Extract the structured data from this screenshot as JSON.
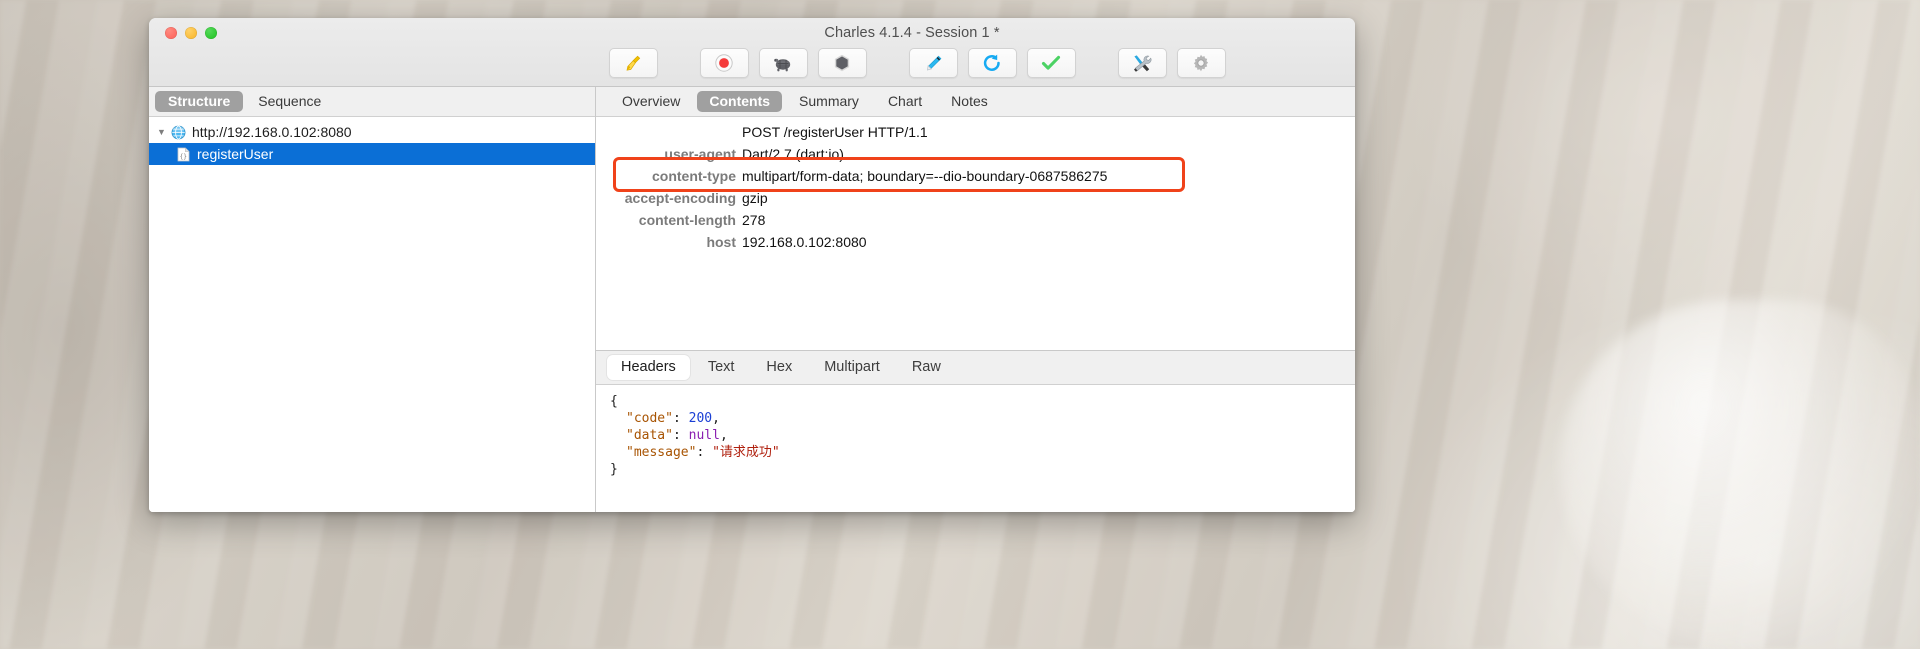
{
  "window": {
    "title": "Charles 4.1.4 - Session 1 *",
    "traffic_lights": [
      "close",
      "minimize",
      "maximize"
    ]
  },
  "toolbar": {
    "buttons": [
      {
        "name": "clear-session-button",
        "icon": "broom-icon",
        "label": "Clear Session"
      },
      {
        "name": "record-button",
        "icon": "record-icon",
        "label": "Start/Stop Recording"
      },
      {
        "name": "throttle-button",
        "icon": "turtle-icon",
        "label": "Start/Stop Throttling"
      },
      {
        "name": "breakpoints-button",
        "icon": "hexagon-icon",
        "label": "Enable/Disable Breakpoints"
      },
      {
        "name": "compose-button",
        "icon": "pen-icon",
        "label": "Compose"
      },
      {
        "name": "repeat-button",
        "icon": "reload-icon",
        "label": "Repeat"
      },
      {
        "name": "validate-button",
        "icon": "checkmark-icon",
        "label": "Validate"
      },
      {
        "name": "tools-button",
        "icon": "tools-icon",
        "label": "Tools"
      },
      {
        "name": "settings-button",
        "icon": "gear-icon",
        "label": "Settings"
      }
    ]
  },
  "left_pane": {
    "tabs": [
      {
        "label": "Structure",
        "active": true
      },
      {
        "label": "Sequence",
        "active": false
      }
    ],
    "tree": [
      {
        "label": "http://192.168.0.102:8080",
        "icon": "globe-icon",
        "expanded": true,
        "selected": false,
        "depth": 0
      },
      {
        "label": "registerUser",
        "icon": "json-doc-icon",
        "expanded": false,
        "selected": true,
        "depth": 1
      }
    ],
    "disclosure_glyph": "▼"
  },
  "right_pane": {
    "tabs": [
      {
        "label": "Overview",
        "active": false
      },
      {
        "label": "Contents",
        "active": true
      },
      {
        "label": "Summary",
        "active": false
      },
      {
        "label": "Chart",
        "active": false
      },
      {
        "label": "Notes",
        "active": false
      }
    ],
    "headers": [
      {
        "name": "",
        "value": "POST /registerUser HTTP/1.1",
        "highlighted": false
      },
      {
        "name": "user-agent",
        "value": "Dart/2.7 (dart:io)",
        "highlighted": false
      },
      {
        "name": "content-type",
        "value": "multipart/form-data; boundary=--dio-boundary-0687586275",
        "highlighted": true
      },
      {
        "name": "accept-encoding",
        "value": "gzip",
        "highlighted": false
      },
      {
        "name": "content-length",
        "value": "278",
        "highlighted": false
      },
      {
        "name": "host",
        "value": "192.168.0.102:8080",
        "highlighted": false
      }
    ],
    "highlight_color": "#f0421a",
    "body_tabs": [
      {
        "label": "Headers",
        "active": true
      },
      {
        "label": "Text",
        "active": false
      },
      {
        "label": "Hex",
        "active": false
      },
      {
        "label": "Multipart",
        "active": false
      },
      {
        "label": "Raw",
        "active": false
      }
    ],
    "response_body": [
      {
        "indent": 0,
        "tokens": [
          {
            "text": "{",
            "cls": "j-punc"
          }
        ]
      },
      {
        "indent": 1,
        "tokens": [
          {
            "text": "\"code\"",
            "cls": "j-key"
          },
          {
            "text": ": ",
            "cls": "j-punc"
          },
          {
            "text": "200",
            "cls": "j-num"
          },
          {
            "text": ",",
            "cls": "j-punc"
          }
        ]
      },
      {
        "indent": 1,
        "tokens": [
          {
            "text": "\"data\"",
            "cls": "j-key"
          },
          {
            "text": ": ",
            "cls": "j-punc"
          },
          {
            "text": "null",
            "cls": "j-null"
          },
          {
            "text": ",",
            "cls": "j-punc"
          }
        ]
      },
      {
        "indent": 1,
        "tokens": [
          {
            "text": "\"message\"",
            "cls": "j-key"
          },
          {
            "text": ": ",
            "cls": "j-punc"
          },
          {
            "text": "\"请求成功\"",
            "cls": "j-str"
          }
        ]
      },
      {
        "indent": 0,
        "tokens": [
          {
            "text": "}",
            "cls": "j-punc"
          }
        ]
      }
    ]
  }
}
